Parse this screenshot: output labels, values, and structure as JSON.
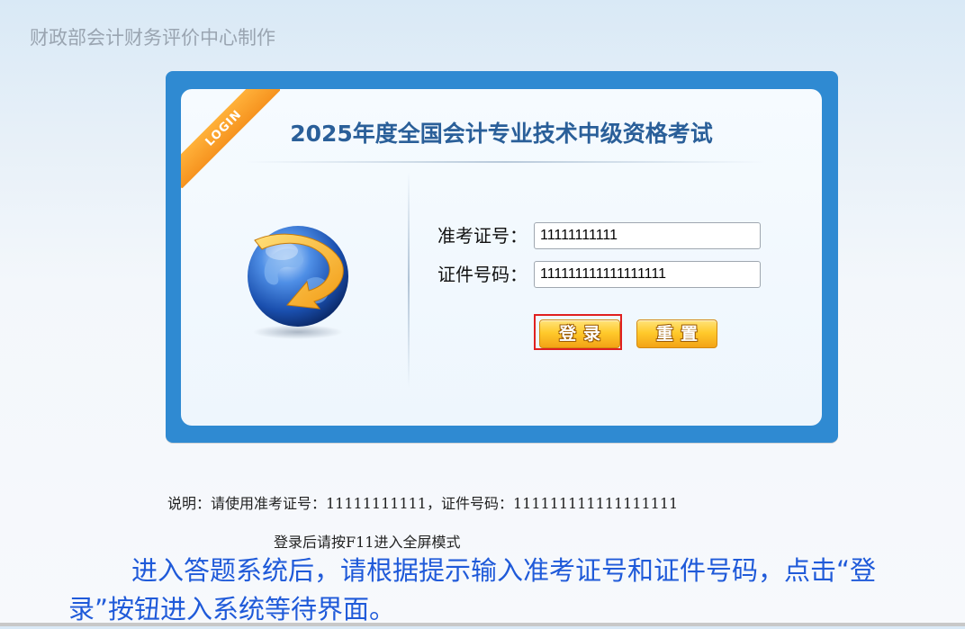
{
  "header": {
    "producer": "财政部会计财务评价中心制作"
  },
  "login": {
    "ribbon_label": "LOGIN",
    "title": "2025年度全国会计专业技术中级资格考试",
    "ticket_label": "准考证号：",
    "ticket_value": "11111111111",
    "id_label": "证件号码：",
    "id_value": "111111111111111111",
    "login_button": "登录",
    "reset_button": "重置"
  },
  "notes": {
    "credentials": "说明：请使用准考证号：11111111111，证件号码：111111111111111111",
    "fullscreen": "登录后请按F11进入全屏模式"
  },
  "instruction": "进入答题系统后，请根据提示输入准考证号和证件号码，点击“登录”按钮进入系统等待界面。",
  "colors": {
    "panel_border": "#2f8ad2",
    "title": "#2a5f99",
    "ribbon": "#f6931f",
    "button": "#ffca2c",
    "highlight": "#e02020",
    "instruction": "#1f5ad9"
  },
  "icons": {
    "globe": "globe-icon"
  }
}
